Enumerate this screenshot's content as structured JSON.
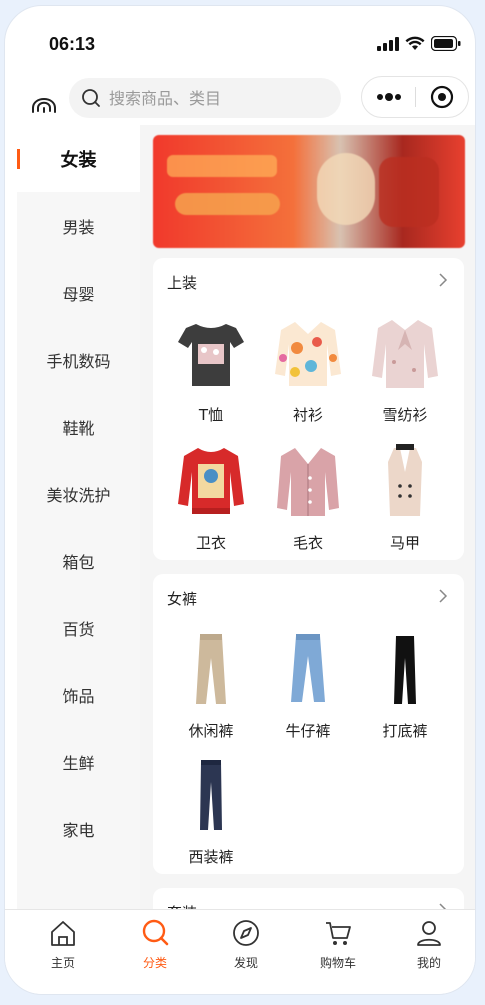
{
  "status": {
    "time": "06:13"
  },
  "search": {
    "placeholder": "搜索商品、类目"
  },
  "sidebar": {
    "items": [
      {
        "label": "女装"
      },
      {
        "label": "男装"
      },
      {
        "label": "母婴"
      },
      {
        "label": "手机数码"
      },
      {
        "label": "鞋靴"
      },
      {
        "label": "美妆洗护"
      },
      {
        "label": "箱包"
      },
      {
        "label": "百货"
      },
      {
        "label": "饰品"
      },
      {
        "label": "生鲜"
      },
      {
        "label": "家电"
      }
    ]
  },
  "sections": [
    {
      "title": "上装",
      "items": [
        {
          "label": "T恤",
          "icon": "tshirt-icon"
        },
        {
          "label": "衬衫",
          "icon": "shirt-icon"
        },
        {
          "label": "雪纺衫",
          "icon": "chiffon-blouse-icon"
        },
        {
          "label": "卫衣",
          "icon": "sweatshirt-icon"
        },
        {
          "label": "毛衣",
          "icon": "sweater-icon"
        },
        {
          "label": "马甲",
          "icon": "vest-icon"
        }
      ]
    },
    {
      "title": "女裤",
      "items": [
        {
          "label": "休闲裤",
          "icon": "casual-pants-icon"
        },
        {
          "label": "牛仔裤",
          "icon": "jeans-icon"
        },
        {
          "label": "打底裤",
          "icon": "leggings-icon"
        },
        {
          "label": "西装裤",
          "icon": "suit-pants-icon"
        }
      ]
    },
    {
      "title": "套装",
      "items": []
    }
  ],
  "tabbar": {
    "items": [
      {
        "label": "主页",
        "icon": "home-icon"
      },
      {
        "label": "分类",
        "icon": "category-search-icon"
      },
      {
        "label": "发现",
        "icon": "compass-icon"
      },
      {
        "label": "购物车",
        "icon": "cart-icon"
      },
      {
        "label": "我的",
        "icon": "profile-icon"
      }
    ]
  },
  "colors": {
    "accent": "#ff5b14",
    "sidebar_bg": "#f7f7f7",
    "page_bg": "#f5f5f5"
  }
}
